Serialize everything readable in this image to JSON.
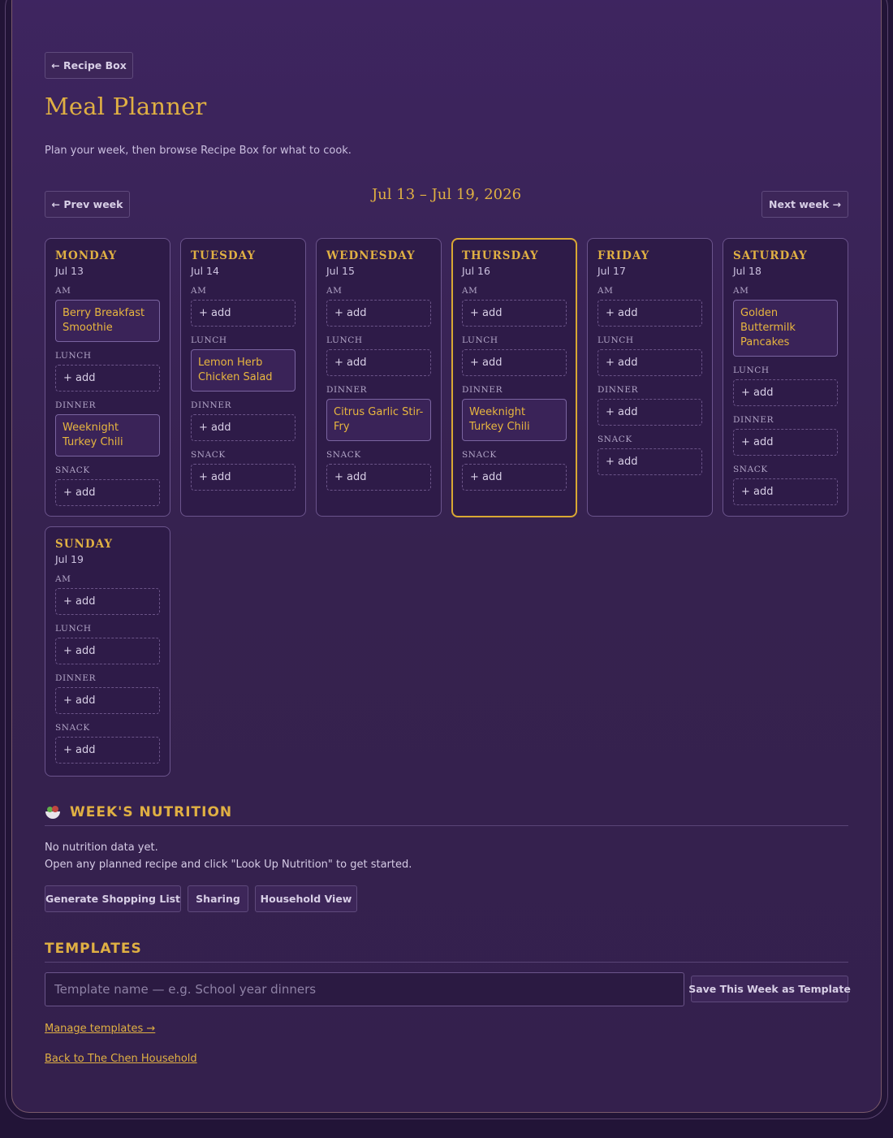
{
  "nav": {
    "back_label": "← Recipe Box"
  },
  "header": {
    "title": "Meal Planner",
    "subtitle": "Plan your week, then browse Recipe Box for what to cook."
  },
  "week": {
    "prev_label": "← Prev week",
    "next_label": "Next week →",
    "range": "Jul 13 – Jul 19, 2026"
  },
  "slot_labels": {
    "am": "AM",
    "lunch": "LUNCH",
    "dinner": "DINNER",
    "snack": "SNACK"
  },
  "add_label": "+ add",
  "days": [
    {
      "name": "MONDAY",
      "date": "Jul 13",
      "am": "Berry Breakfast Smoothie",
      "lunch": "",
      "dinner": "Weeknight Turkey Chili",
      "snack": ""
    },
    {
      "name": "TUESDAY",
      "date": "Jul 14",
      "am": "",
      "lunch": "Lemon Herb Chicken Salad",
      "dinner": "",
      "snack": ""
    },
    {
      "name": "WEDNESDAY",
      "date": "Jul 15",
      "am": "",
      "lunch": "",
      "dinner": "Citrus Garlic Stir-Fry",
      "snack": ""
    },
    {
      "name": "THURSDAY",
      "date": "Jul 16",
      "am": "",
      "lunch": "",
      "dinner": "Weeknight Turkey Chili",
      "snack": "",
      "today": true
    },
    {
      "name": "FRIDAY",
      "date": "Jul 17",
      "am": "",
      "lunch": "",
      "dinner": "",
      "snack": ""
    },
    {
      "name": "SATURDAY",
      "date": "Jul 18",
      "am": "Golden Buttermilk Pancakes",
      "lunch": "",
      "dinner": "",
      "snack": ""
    },
    {
      "name": "SUNDAY",
      "date": "Jul 19",
      "am": "",
      "lunch": "",
      "dinner": "",
      "snack": ""
    }
  ],
  "nutrition": {
    "heading": "WEEK'S NUTRITION",
    "icon": "salad-bowl-icon",
    "empty_line1": "No nutrition data yet.",
    "empty_line2": "Open any planned recipe and click \"Look Up Nutrition\" to get started."
  },
  "actions": {
    "shopping_list": "Generate Shopping List",
    "sharing": "Sharing",
    "household_view": "Household View"
  },
  "templates": {
    "heading": "TEMPLATES",
    "input_placeholder": "Template name — e.g. School year dinners",
    "input_value": "",
    "save_label": "Save This Week as Template",
    "manage_link": "Manage templates →"
  },
  "footer": {
    "back_link": "Back to The Chen Household"
  },
  "colors": {
    "accent": "#e0b043",
    "background": "#3a2358",
    "today_border": "#d9a833"
  }
}
